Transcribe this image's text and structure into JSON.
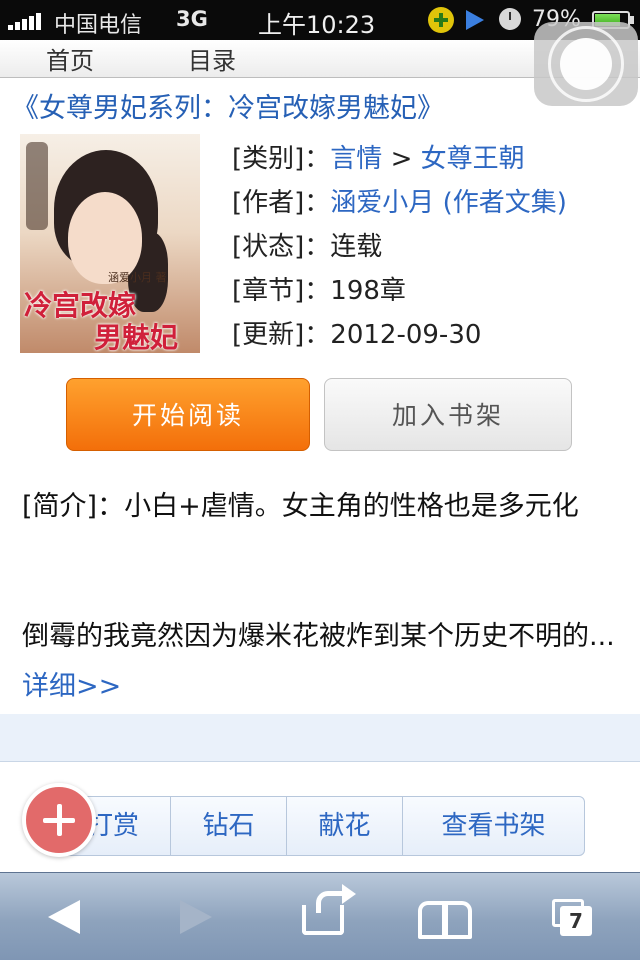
{
  "status_bar": {
    "carrier": "中国电信",
    "network": "3G",
    "time": "上午10:23",
    "battery_percent": "79%",
    "battery_level": 0.79,
    "icons": [
      "signal-bars-icon",
      "plus-badge-icon",
      "play-icon",
      "clock-icon",
      "battery-icon"
    ]
  },
  "nav": {
    "home": "首页",
    "catalog": "目录"
  },
  "book": {
    "title": "《女尊男妃系列：冷宫改嫁男魅妃》",
    "cover": {
      "author_text": "涵爱小月 著",
      "title_line1": "冷宫改嫁",
      "title_line2": "男魅妃"
    },
    "category_label": "[类别]：",
    "category_main": "言情",
    "category_sep": " > ",
    "category_sub": "女尊王朝",
    "author_label": "[作者]：",
    "author": "涵爱小月",
    "author_works": " (作者文集)",
    "status_label": "[状态]：",
    "status": "连载",
    "chapters_label": "[章节]：",
    "chapters": "198章",
    "updated_label": "[更新]：",
    "updated": "2012-09-30"
  },
  "buttons": {
    "start_reading": "开始阅读",
    "add_to_shelf": "加入书架"
  },
  "intro": {
    "line1": "[简介]：小白+虐情。女主角的性格也是多元化",
    "line2": "倒霉的我竟然因为爆米花被炸到某个历史不明的...",
    "more": "详细>>"
  },
  "actions": {
    "tip": "打赏",
    "diamond": "钻石",
    "flower": "献花",
    "view_shelf": "查看书架"
  },
  "toolbar": {
    "tab_count": "7",
    "icons": [
      "back-icon",
      "forward-icon",
      "share-icon",
      "bookmarks-icon",
      "tabs-icon"
    ]
  }
}
